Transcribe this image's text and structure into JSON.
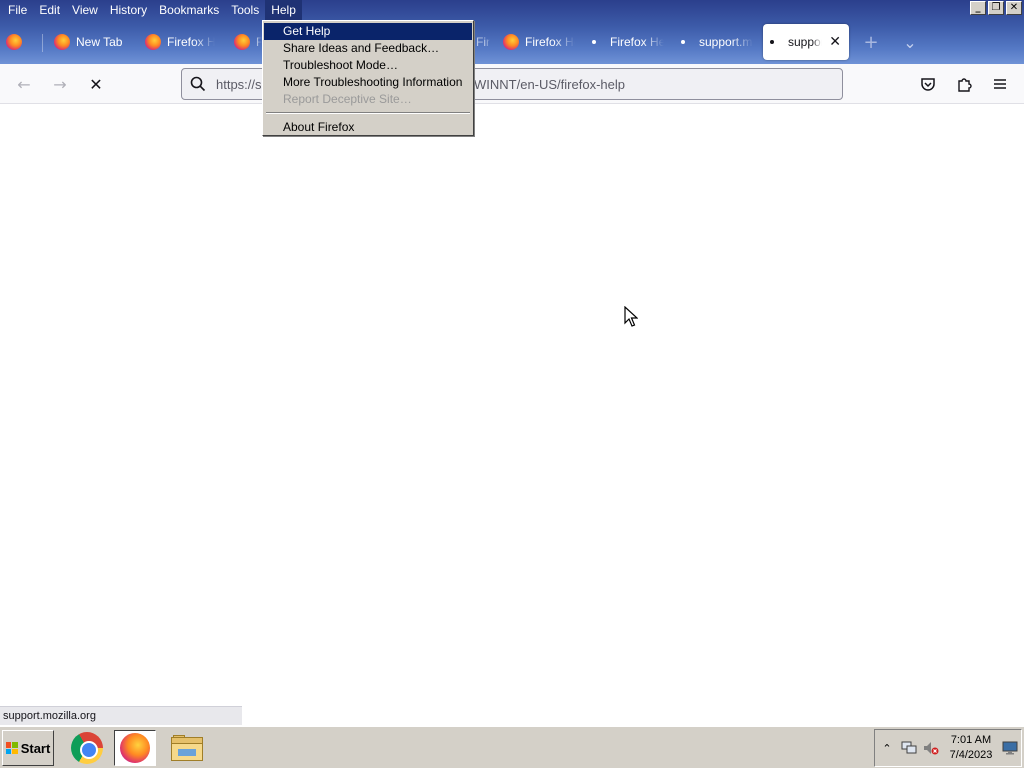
{
  "menubar": {
    "items": [
      "File",
      "Edit",
      "View",
      "History",
      "Bookmarks",
      "Tools",
      "Help"
    ]
  },
  "tabs": [
    {
      "label": "New Tab",
      "icon": "firefox-icon"
    },
    {
      "label": "Firefox Help",
      "icon": "firefox-icon"
    },
    {
      "label": "Firefox Help",
      "icon": "firefox-icon"
    },
    {
      "label": "Firefox Help",
      "icon": "firefox-icon"
    },
    {
      "label": "Firefox Help",
      "icon": "loading-dot-icon"
    },
    {
      "label": "support.mozilla.org",
      "icon": "loading-dot-icon"
    },
    {
      "label": "support.mozilla.org",
      "icon": "loading-dot-icon",
      "selected": true
    }
  ],
  "tab_close_glyph": "✕",
  "new_tab_glyph": "+",
  "tab_list_glyph": "⌄",
  "urlbar": {
    "visible_prefix": "https://s",
    "visible_suffix": "WINNT/en-US/firefox-help"
  },
  "help_menu": {
    "items": [
      {
        "label": "Get Help",
        "state": "highlighted"
      },
      {
        "label": "Share Ideas and Feedback…",
        "state": "normal"
      },
      {
        "label": "Troubleshoot Mode…",
        "state": "normal"
      },
      {
        "label": "More Troubleshooting Information",
        "state": "normal"
      },
      {
        "label": "Report Deceptive Site…",
        "state": "disabled"
      },
      {
        "label": "About Firefox",
        "state": "normal"
      }
    ]
  },
  "status_bar": {
    "text": "support.mozilla.org"
  },
  "taskbar": {
    "start_label": "Start",
    "clock_time": "7:01 AM",
    "clock_date": "7/4/2023"
  },
  "colors": {
    "menu_highlight": "#0a246a",
    "titlebar_top": "#2b3f8c",
    "titlebar_bottom": "#6f92d6"
  }
}
